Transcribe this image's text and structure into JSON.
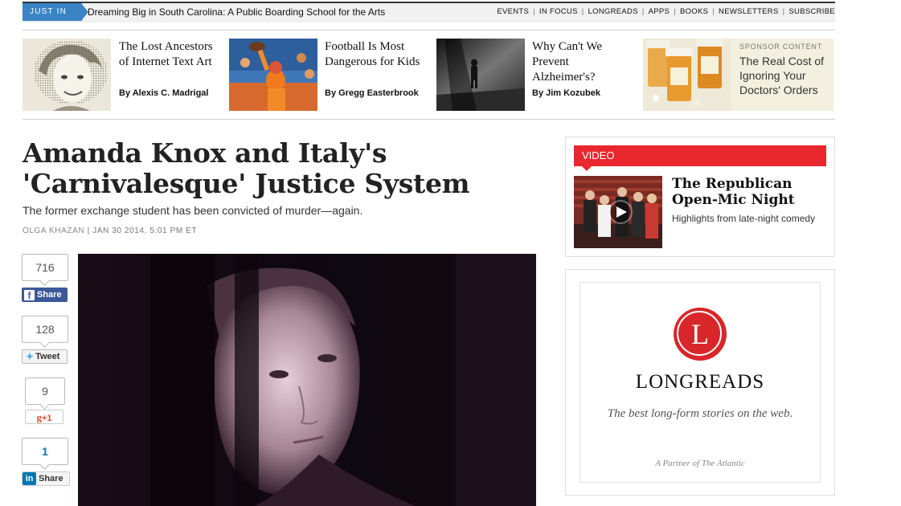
{
  "topbar": {
    "tag": "JUST IN",
    "headline": "Dreaming Big in South Carolina: A Public Boarding School for the Arts",
    "nav": [
      "EVENTS",
      "IN FOCUS",
      "LONGREADS",
      "APPS",
      "BOOKS",
      "NEWSLETTERS",
      "SUBSCRIBE"
    ]
  },
  "promos": [
    {
      "title": "The Lost Ancestors of Internet Text Art",
      "byline": "By Alexis C. Madrigal"
    },
    {
      "title": "Football Is Most Dangerous for Kids",
      "byline": "By Gregg Easterbrook"
    },
    {
      "title": "Why Can't We Prevent Alzheimer's?",
      "byline": "By Jim Kozubek"
    }
  ],
  "sponsor": {
    "tag": "SPONSOR CONTENT",
    "title": "The Real Cost of Ignoring Your Doctors' Orders"
  },
  "article": {
    "title": "Amanda Knox and Italy's 'Carnivalesque' Justice System",
    "dek": "The former exchange student has been convicted of murder—again.",
    "author": "OLGA KHAZAN",
    "date": "JAN 30 2014, 5:01 PM ET"
  },
  "social": {
    "facebook": {
      "count": "716",
      "label": "Share"
    },
    "twitter": {
      "count": "128",
      "label": "Tweet"
    },
    "google": {
      "count": "9",
      "label": "+1"
    },
    "linkedin": {
      "count": "1",
      "label": "Share",
      "logo": "in"
    }
  },
  "video": {
    "label": "VIDEO",
    "title": "The Republican Open-Mic Night",
    "subtitle": "Highlights from late-night comedy"
  },
  "ad": {
    "logo_letter": "L",
    "brand": "LONGREADS",
    "tagline": "The best long-form stories on the web.",
    "partner": "A Partner of The Atlantic"
  },
  "colors": {
    "just_in": "#3a84c6",
    "video_red": "#e8282e",
    "facebook": "#3b5998",
    "twitter": "#55acee",
    "google": "#dd4b39",
    "linkedin": "#0077b5"
  }
}
